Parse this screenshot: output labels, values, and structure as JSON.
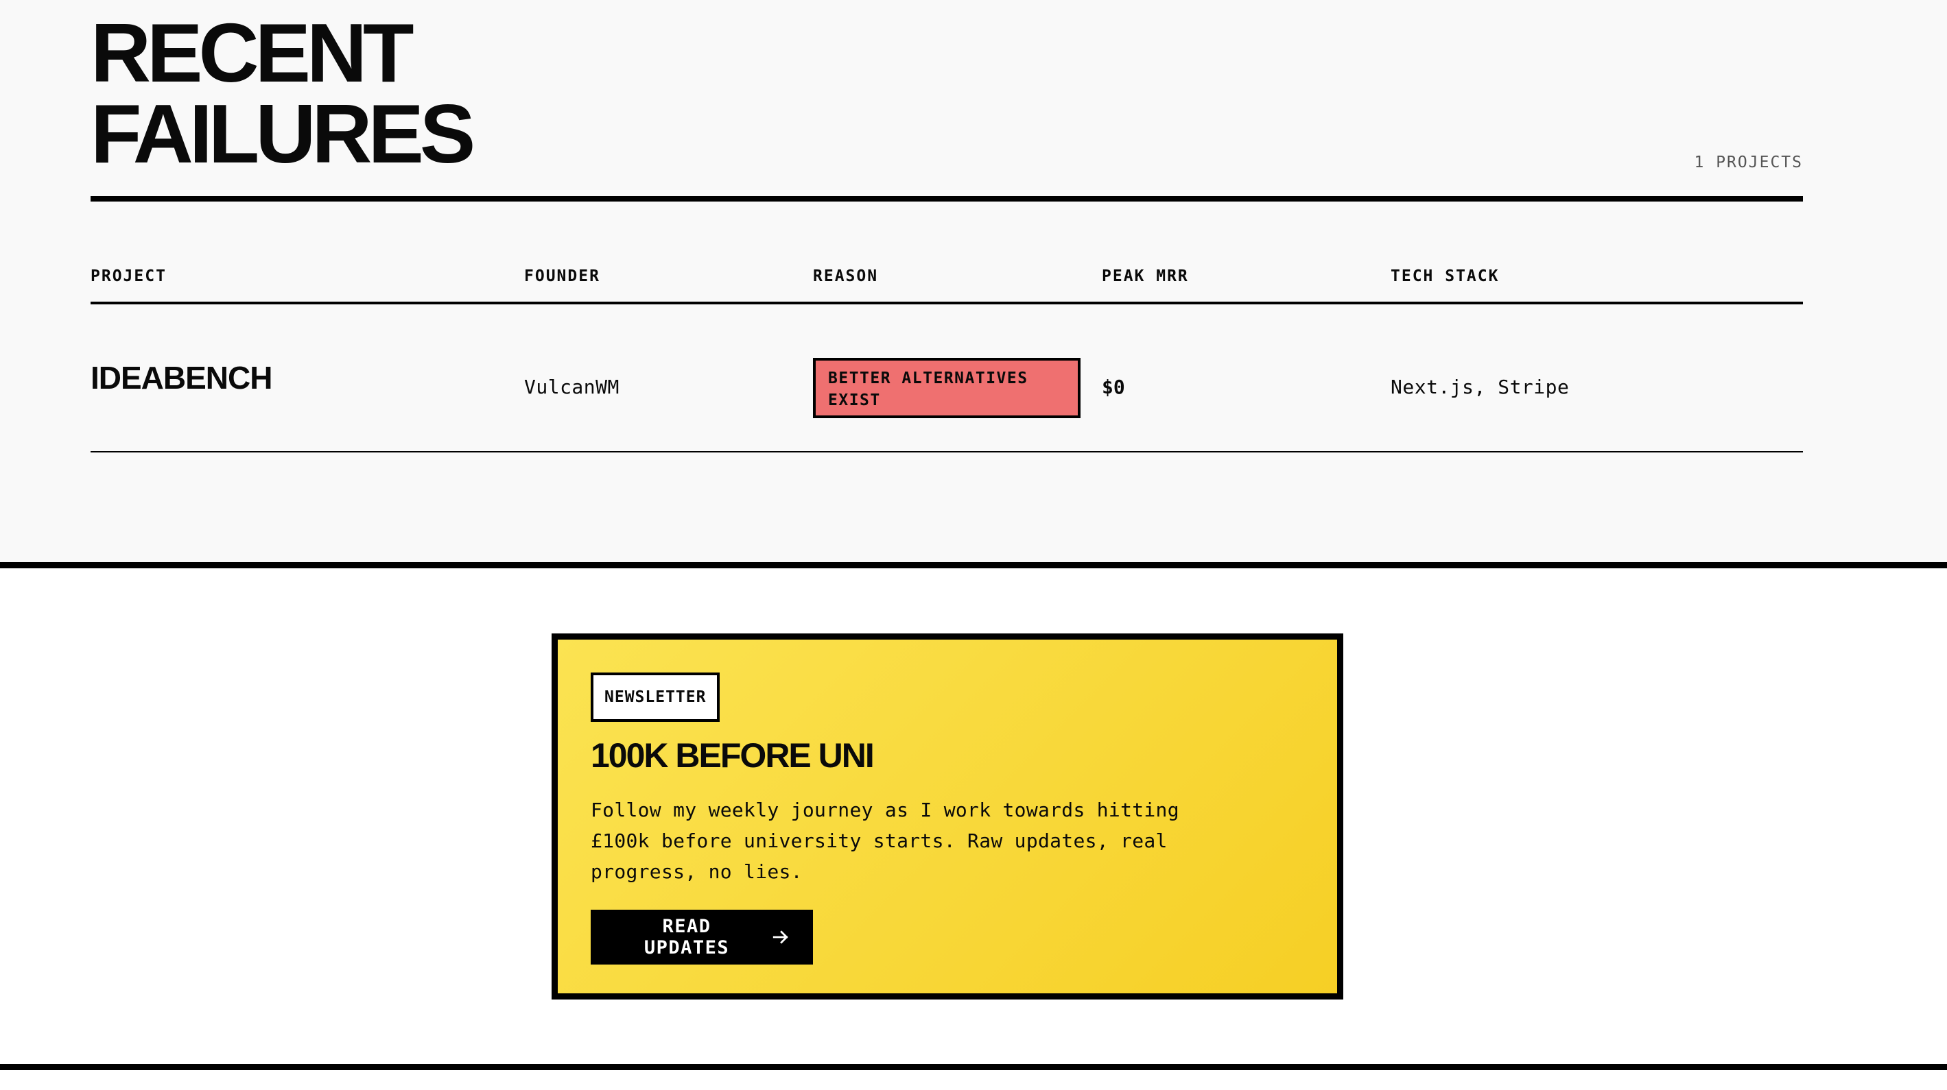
{
  "failures": {
    "title_line1": "RECENT",
    "title_line2": "FAILURES",
    "count_label": "1 PROJECTS",
    "columns": [
      "PROJECT",
      "FOUNDER",
      "REASON",
      "PEAK MRR",
      "TECH STACK"
    ],
    "rows": [
      {
        "project": "IDEABENCH",
        "founder": "VulcanWM",
        "reason": "BETTER ALTERNATIVES EXIST",
        "peak_mrr": "$0",
        "tech_stack": "Next.js, Stripe"
      }
    ],
    "colors": {
      "section_bg": "#f9f9f9",
      "reason_badge": "#ef7070"
    }
  },
  "newsletter": {
    "tag": "NEWSLETTER",
    "title": "100K BEFORE UNI",
    "description": "Follow my weekly journey as I work towards hitting £100k before university starts. Raw updates, real progress, no lies.",
    "cta_label": "READ UPDATES",
    "cta_icon": "arrow-right-icon",
    "colors": {
      "card_gradient_start": "#fbe352",
      "card_gradient_end": "#f6cf25",
      "cta_bg": "#000000"
    }
  }
}
